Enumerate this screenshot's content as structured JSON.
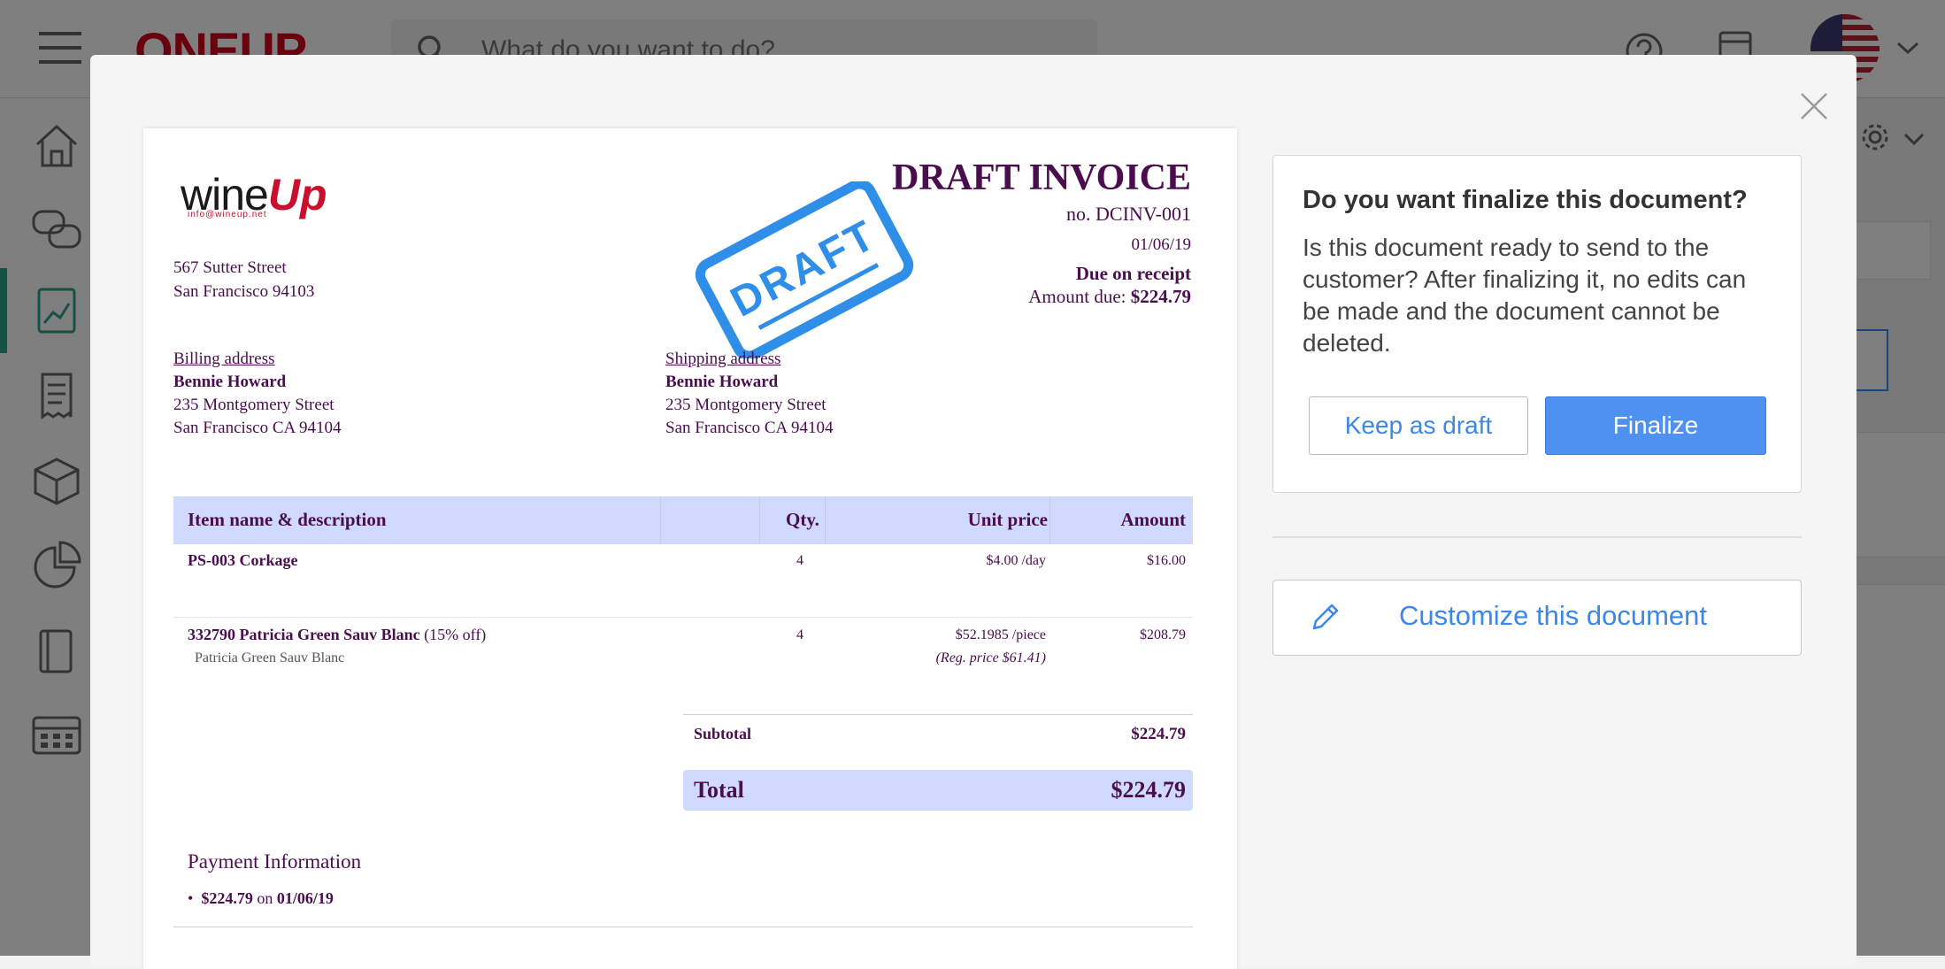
{
  "app": {
    "brand": "ONEUP",
    "search_placeholder": "What do you want to do?",
    "icons": {
      "menu": "hamburger-icon",
      "search": "search-icon",
      "help": "help-icon",
      "document": "document-icon",
      "language": "us-flag-icon",
      "settings": "gear-icon"
    },
    "sidebar": [
      "home-icon",
      "chat-icon",
      "sales-chart-icon",
      "receipt-icon",
      "inventory-box-icon",
      "reports-pie-icon",
      "book-icon",
      "calculator-icon"
    ],
    "colors": {
      "brand_red": "#d0021b",
      "sidebar_active": "#2aa38b"
    }
  },
  "invoice": {
    "company_logo": {
      "text_a": "wine",
      "text_b": "Up",
      "email": "info@wineup.net"
    },
    "from_address": [
      "567 Sutter Street",
      "San Francisco 94103"
    ],
    "stamp": "DRAFT",
    "title": "DRAFT INVOICE",
    "number": "no. DCINV-001",
    "date": "01/06/19",
    "terms": "Due on receipt",
    "amount_due_label": "Amount due: ",
    "amount_due": "$224.79",
    "billing": {
      "label": "Billing address",
      "name": "Bennie Howard",
      "street": "235 Montgomery Street",
      "city": "San Francisco CA 94104"
    },
    "shipping": {
      "label": "Shipping address",
      "name": "Bennie Howard",
      "street": "235 Montgomery Street",
      "city": "San Francisco CA 94104"
    },
    "table": {
      "headers": {
        "item": "Item name & description",
        "qty": "Qty.",
        "unit_price": "Unit price",
        "amount": "Amount"
      },
      "rows": [
        {
          "name": "PS-003 Corkage",
          "note": "",
          "desc": "",
          "qty": "4",
          "price": "$4.00 /day",
          "reg_price": "",
          "amount": "$16.00"
        },
        {
          "name": "332790 Patricia Green Sauv Blanc",
          "note": " (15% off)",
          "desc": "Patricia Green Sauv Blanc",
          "qty": "4",
          "price": "$52.1985 /piece",
          "reg_price": "(Reg. price $61.41)",
          "amount": "$208.79"
        }
      ]
    },
    "subtotal_label": "Subtotal",
    "subtotal": "$224.79",
    "total_label": "Total",
    "total": "$224.79",
    "payment": {
      "title": "Payment Information",
      "amount": "$224.79",
      "on": " on ",
      "date": "01/06/19"
    },
    "colors": {
      "text": "#4a0e4e",
      "header_fill": "#d0dafc",
      "stamp": "#2f8ee8"
    }
  },
  "dialog": {
    "title": "Do you want finalize this document?",
    "message": "Is this document ready to send to the customer? After finalizing it, no edits can be made and the document cannot be deleted.",
    "keep_label": "Keep as draft",
    "finalize_label": "Finalize",
    "customize_label": "Customize this document",
    "colors": {
      "primary": "#4f91f0",
      "link": "#3c87e8"
    }
  }
}
